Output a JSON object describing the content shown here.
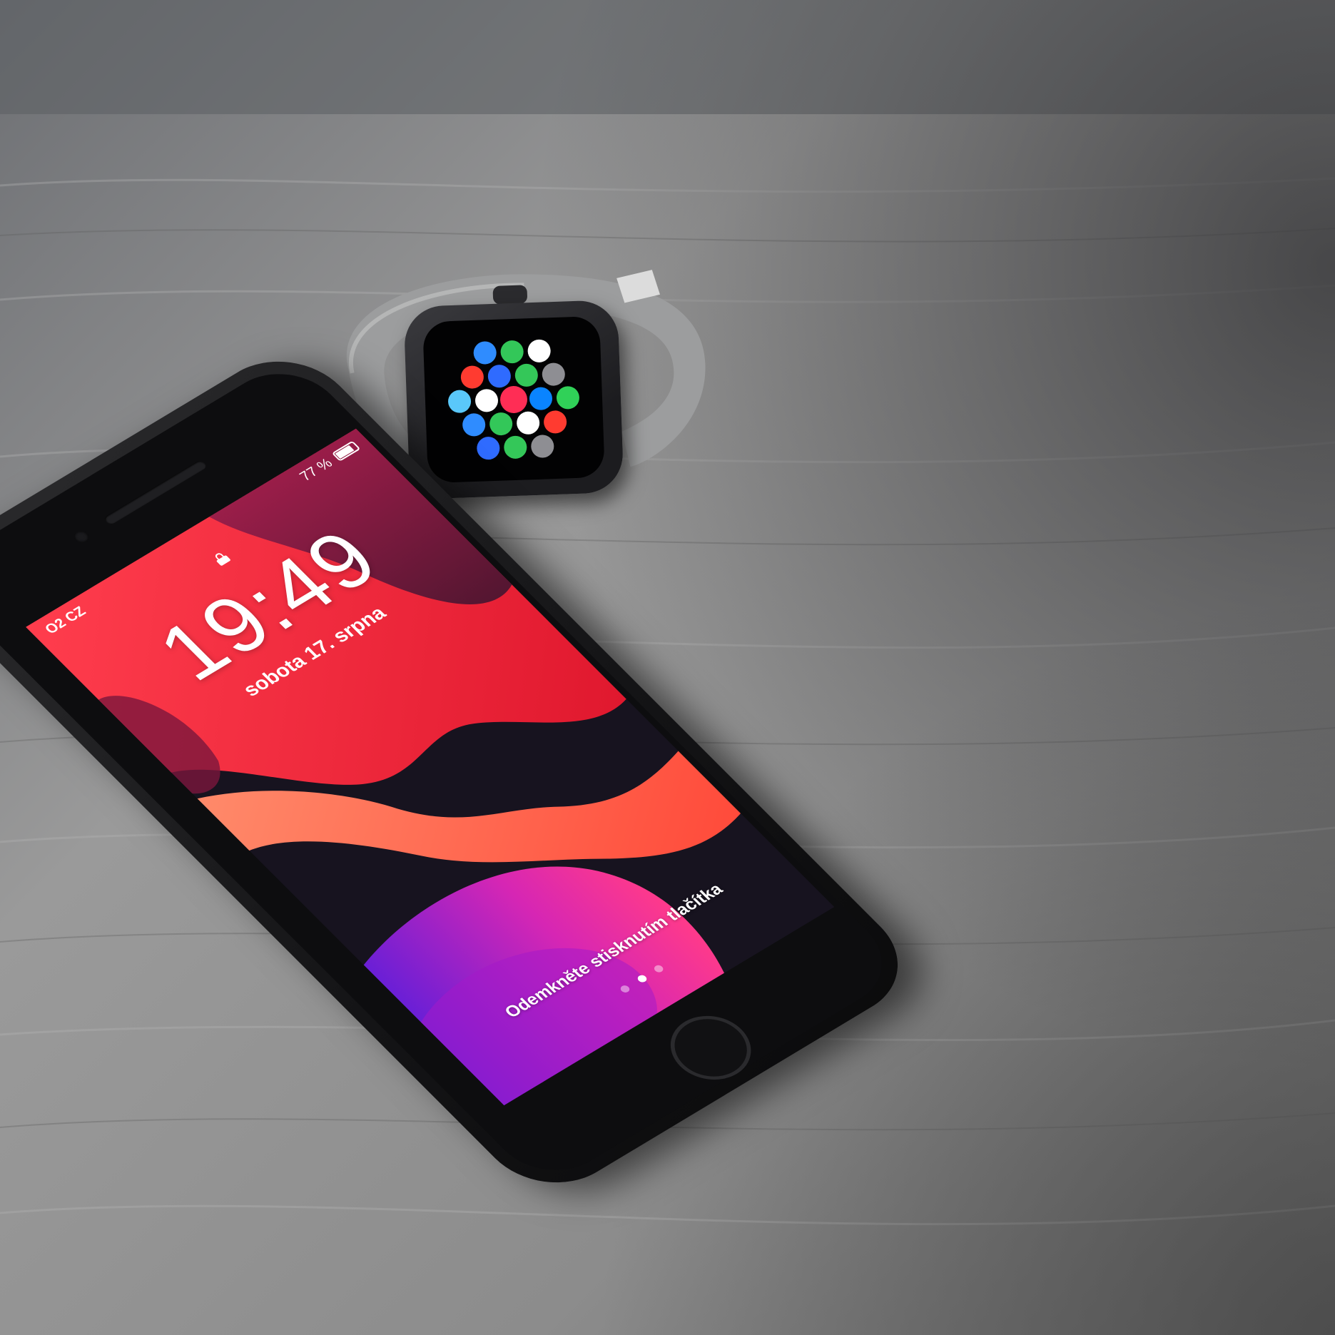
{
  "phone": {
    "status_carrier": "O2 CZ",
    "status_battery": "77 %",
    "battery_level": 0.77,
    "clock": "19:49",
    "date": "sobota 17. srpna",
    "unlock_hint": "Odemkněte stisknutím tlačítka",
    "page_dots": 3,
    "active_page_dot": 2
  },
  "watch": {
    "app_icon_colors": [
      "#2f8cff",
      "#33c759",
      "#ffffff",
      "#ff3b30",
      "#2f6bff",
      "#34c759",
      "#8e8e93",
      "#5ac8fa",
      "#ffffff",
      "#ff2d55",
      "#0a84ff",
      "#30d158"
    ]
  },
  "colors": {
    "table": "#8f8f8f",
    "wallpaper_red": "#ff2a3a",
    "wallpaper_orange": "#ff6a4a",
    "wallpaper_magenta": "#e026b8",
    "wallpaper_purple": "#6a1fd6",
    "wallpaper_dark": "#17131f"
  }
}
